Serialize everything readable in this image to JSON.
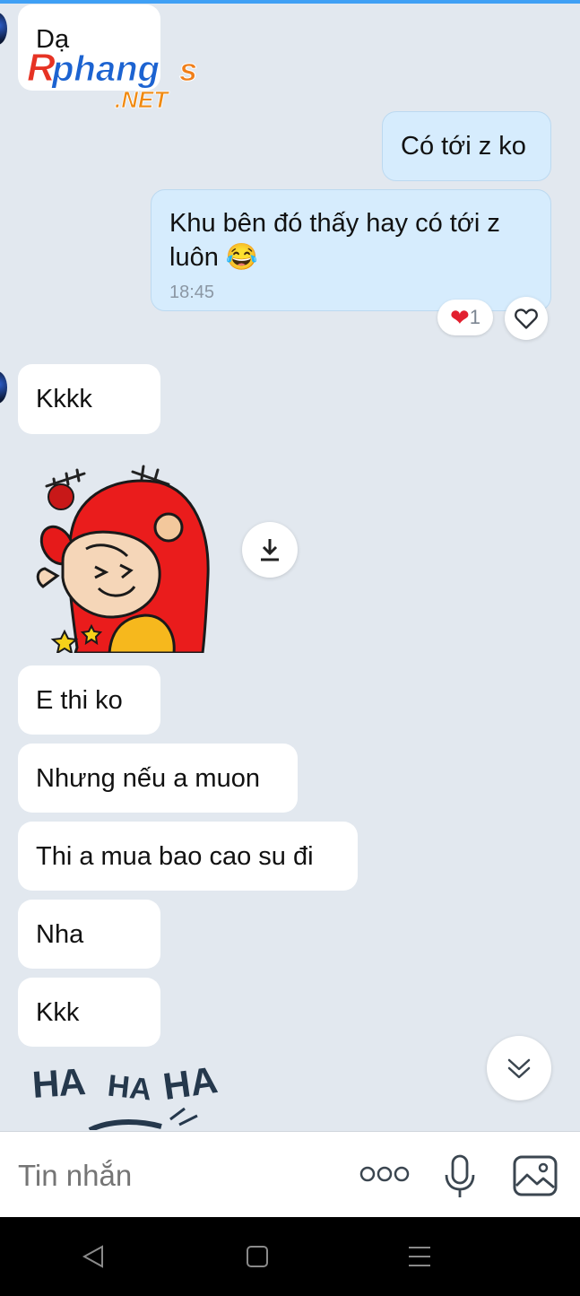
{
  "messages": {
    "m1": "Dạ",
    "m2": "Có tới z ko",
    "m3": "Khu bên đó thấy hay có tới z luôn 😂",
    "m3_time": "18:45",
    "m3_reaction_count": "1",
    "m4": "Kkkk",
    "m5": "E thi ko",
    "m6": "Nhưng nếu a muon",
    "m7": "Thi a mua bao cao su đi",
    "m8": "Nha",
    "m9": "Kkk"
  },
  "watermark": {
    "name": "Rphangs",
    "domain": ".NET"
  },
  "sticker2_text": [
    "HA",
    "HA",
    "HA"
  ],
  "composer": {
    "placeholder": "Tin nhắn"
  },
  "icons": {
    "reaction": "heart-filled-icon",
    "like": "heart-outline-icon",
    "download": "download-icon",
    "scroll": "chevron-double-down-icon",
    "more": "more-dots-icon",
    "mic": "microphone-icon",
    "image": "image-icon",
    "back": "back-triangle-icon",
    "home": "home-square-icon",
    "recents": "menu-lines-icon"
  },
  "colors": {
    "accent": "#3fa0f5",
    "outgoing": "#d6ecfd",
    "incoming": "#ffffff",
    "background": "#e2e8ef"
  }
}
